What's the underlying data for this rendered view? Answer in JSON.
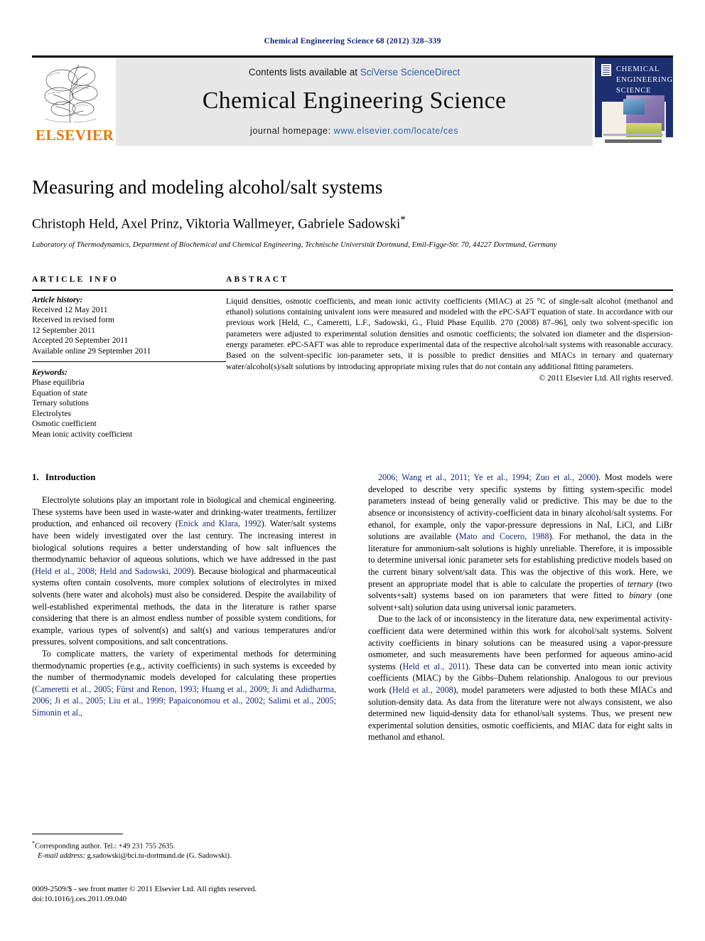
{
  "running_head": "Chemical Engineering Science 68 (2012) 328–339",
  "masthead": {
    "contents_prefix": "Contents lists available at ",
    "contents_link": "SciVerse ScienceDirect",
    "journal_title": "Chemical Engineering Science",
    "homepage_prefix": "journal homepage: ",
    "homepage_url": "www.elsevier.com/locate/ces",
    "publisher_wordmark": "ELSEVIER",
    "cover_title_lines": [
      "CHEMICAL",
      "ENGINEERING",
      "SCIENCE"
    ],
    "brand_color": "#ec7404",
    "link_color": "#2f5fa8",
    "cover_bg_color": "#1d2f6f",
    "band_color": "#e7e7e7"
  },
  "article": {
    "title": "Measuring and modeling alcohol/salt systems",
    "authors": "Christoph Held, Axel Prinz, Viktoria Wallmeyer, Gabriele Sadowski",
    "corresponding_marker": "*",
    "affiliation": "Laboratory of Thermodynamics, Department of Biochemical and Chemical Engineering, Technische Universität Dortmund, Emil-Figge-Str. 70, 44227 Dortmund, Germany"
  },
  "article_info": {
    "heading": "ARTICLE INFO",
    "history_label": "Article history:",
    "history_lines": [
      "Received 12 May 2011",
      "Received in revised form",
      "12 September 2011",
      "Accepted 20 September 2011",
      "Available online 29 September 2011"
    ],
    "keywords_label": "Keywords:",
    "keywords": [
      "Phase equilibria",
      "Equation of state",
      "Ternary solutions",
      "Electrolytes",
      "Osmotic coefficient",
      "Mean ionic activity coefficient"
    ]
  },
  "abstract": {
    "heading": "ABSTRACT",
    "text": "Liquid densities, osmotic coefficients, and mean ionic activity coefficients (MIAC) at 25 °C of single-salt alcohol (methanol and ethanol) solutions containing univalent ions were measured and modeled with the ePC-SAFT equation of state. In accordance with our previous work [Held, C., Cameretti, L.F., Sadowski, G., Fluid Phase Equilib. 270 (2008) 87–96], only two solvent-specific ion parameters were adjusted to experimental solution densities and osmotic coefficients; the solvated ion diameter and the dispersion-energy parameter. ePC-SAFT was able to reproduce experimental data of the respective alcohol/salt systems with reasonable accuracy. Based on the solvent-specific ion-parameter sets, it is possible to predict densities and MIACs in ternary and quaternary water/alcohol(s)/salt solutions by introducing appropriate mixing rules that do not contain any additional fitting parameters.",
    "copyright": "© 2011 Elsevier Ltd. All rights reserved."
  },
  "introduction": {
    "number": "1.",
    "heading": "Introduction",
    "left_paragraphs": [
      {
        "segments": [
          {
            "t": "Electrolyte solutions play an important role in biological and chemical engineering. These systems have been used in waste-water and drinking-water treatments, fertilizer production, and enhanced oil recovery (",
            "k": "plain"
          },
          {
            "t": "Enick and Klara, 1992",
            "k": "cite"
          },
          {
            "t": "). Water/salt systems have been widely investigated over the last century. The increasing interest in biological solutions requires a better understanding of how salt influences the thermodynamic behavior of aqueous solutions, which we have addressed in the past (",
            "k": "plain"
          },
          {
            "t": "Held et al., 2008; Held and Sadowski, 2009",
            "k": "cite"
          },
          {
            "t": "). Because biological and pharmaceutical systems often contain cosolvents, more complex solutions of electrolytes in mixed solvents (here water and alcohols) must also be considered. Despite the availability of well-established experimental methods, the data in the literature is rather sparse considering that there is an almost endless number of possible system conditions, for example, various types of solvent(s) and salt(s) and various temperatures and/or pressures, solvent compositions, and salt concentrations.",
            "k": "plain"
          }
        ]
      },
      {
        "segments": [
          {
            "t": "To complicate matters, the variety of experimental methods for determining thermodynamic properties (e.g., activity coefficients) in such systems is exceeded by the number of thermodynamic models developed for calculating these properties (",
            "k": "plain"
          },
          {
            "t": "Cameretti et al., 2005; Fürst and Renon, 1993; Huang et al., 2009; Ji and Adidharma, 2006; Ji et al., 2005; Liu et al., 1999; Papaiconomou et al., 2002; Salimi et al., 2005; Simonin et al.,",
            "k": "cite"
          }
        ]
      }
    ],
    "right_paragraphs": [
      {
        "segments": [
          {
            "t": "2006; Wang et al., 2011; Ye et al., 1994; Zuo et al., 2000",
            "k": "cite"
          },
          {
            "t": "). Most models were developed to describe very specific systems by fitting system-specific model parameters instead of being generally valid or predictive. This may be due to the absence or inconsistency of activity-coefficient data in binary alcohol/salt systems. For ethanol, for example, only the vapor-pressure depressions in NaI, LiCl, and LiBr solutions are available (",
            "k": "plain"
          },
          {
            "t": "Mato and Cocero, 1988",
            "k": "cite"
          },
          {
            "t": "). For methanol, the data in the literature for ammonium-salt solutions is highly unreliable. Therefore, it is impossible to determine universal ionic parameter sets for establishing predictive models based on the current binary solvent/salt data. This was the objective of this work. Here, we present an appropriate model that is able to calculate the properties of ",
            "k": "plain"
          },
          {
            "t": "ternary",
            "k": "italic"
          },
          {
            "t": " (two solvents+salt) systems based on ion parameters that were fitted to ",
            "k": "plain"
          },
          {
            "t": "binary",
            "k": "italic"
          },
          {
            "t": " (one solvent+salt) solution data using universal ionic parameters.",
            "k": "plain"
          }
        ]
      },
      {
        "segments": [
          {
            "t": "Due to the lack of or inconsistency in the literature data, new experimental activity-coefficient data were determined within this work for alcohol/salt systems. Solvent activity coefficients in binary solutions can be measured using a vapor-pressure osmometer, and such measurements have been performed for aqueous amino-acid systems (",
            "k": "plain"
          },
          {
            "t": "Held et al., 2011",
            "k": "cite"
          },
          {
            "t": "). These data can be converted into mean ionic activity coefficients (MIAC) by the Gibbs–Duhem relationship. Analogous to our previous work (",
            "k": "plain"
          },
          {
            "t": "Held et al., 2008",
            "k": "cite"
          },
          {
            "t": "), model parameters were adjusted to both these MIACs and solution-density data. As data from the literature were not always consistent, we also determined new liquid-density data for ethanol/salt systems. Thus, we present new experimental solution densities, osmotic coefficients, and MIAC data for eight salts in methanol and ethanol.",
            "k": "plain"
          }
        ]
      }
    ]
  },
  "footnote": {
    "corresponding": "Corresponding author. Tel.: +49 231 755 2635.",
    "email_label": "E-mail address:",
    "email": "g.sadowski@bci.tu-dortmund.de (G. Sadowski)."
  },
  "imprint": {
    "line1": "0009-2509/$ - see front matter © 2011 Elsevier Ltd. All rights reserved.",
    "line2": "doi:10.1016/j.ces.2011.09.040"
  }
}
